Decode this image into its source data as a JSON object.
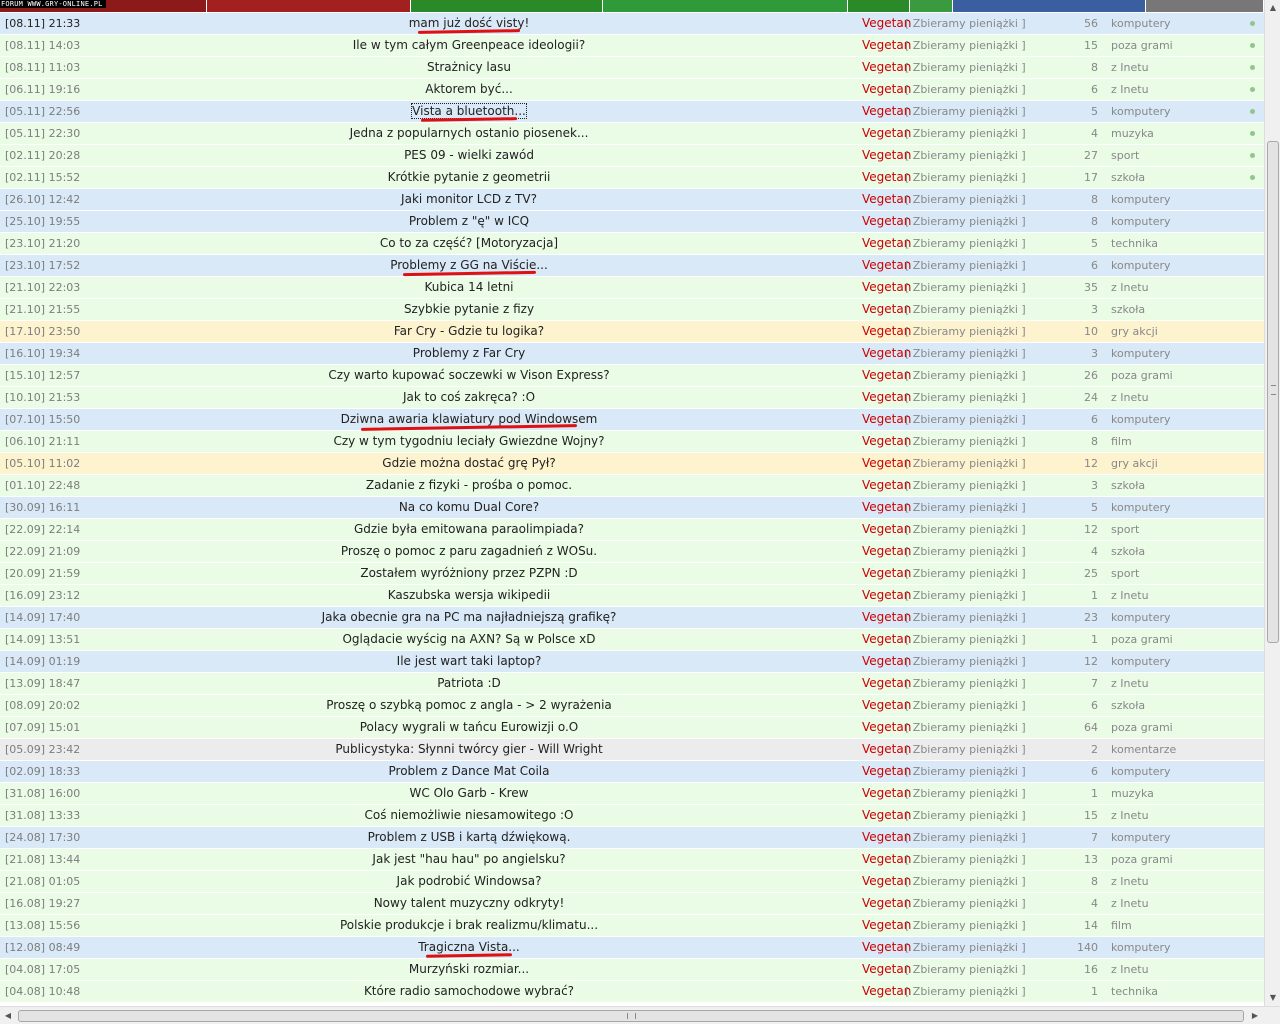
{
  "site_label": "FORUM WWW.GRY-ONLINE.PL",
  "colors": {
    "author": "#cc0000",
    "row_green": "#eafbe6",
    "row_blue": "#d9e9f7",
    "row_yellow": "#fdf3cf",
    "row_gray": "#ececec",
    "underline": "#e01010"
  },
  "threads": [
    {
      "date": "[08.11] 21:33",
      "title": "mam już dość visty!",
      "author": "Vegetan",
      "team": "[ Zbieramy pieniążki ]",
      "count": "56",
      "category": "komputery",
      "dot": true,
      "color": "blue",
      "underlined": true
    },
    {
      "date": "[08.11] 14:03",
      "title": "Ile w tym całym Greenpeace ideologii?",
      "author": "Vegetan",
      "team": "[ Zbieramy pieniążki ]",
      "count": "15",
      "category": "poza grami",
      "dot": true,
      "color": "green"
    },
    {
      "date": "[08.11] 11:03",
      "title": "Strażnicy lasu",
      "author": "Vegetan",
      "team": "[ Zbieramy pieniążki ]",
      "count": "8",
      "category": "z Inetu",
      "dot": true,
      "color": "green"
    },
    {
      "date": "[06.11] 19:16",
      "title": "Aktorem być...",
      "author": "Vegetan",
      "team": "[ Zbieramy pieniążki ]",
      "count": "6",
      "category": "z Inetu",
      "dot": true,
      "color": "green"
    },
    {
      "date": "[05.11] 22:56",
      "title": "Vista a bluetooth...",
      "author": "Vegetan",
      "team": "[ Zbieramy pieniążki ]",
      "count": "5",
      "category": "komputery",
      "dot": true,
      "color": "blue",
      "underlined": true,
      "boxed": true
    },
    {
      "date": "[05.11] 22:30",
      "title": "Jedna z popularnych ostanio piosenek...",
      "author": "Vegetan",
      "team": "[ Zbieramy pieniążki ]",
      "count": "4",
      "category": "muzyka",
      "dot": true,
      "color": "green"
    },
    {
      "date": "[02.11] 20:28",
      "title": "PES 09 - wielki zawód",
      "author": "Vegetan",
      "team": "[ Zbieramy pieniążki ]",
      "count": "27",
      "category": "sport",
      "dot": true,
      "color": "green"
    },
    {
      "date": "[02.11] 15:52",
      "title": "Krótkie pytanie z geometrii",
      "author": "Vegetan",
      "team": "[ Zbieramy pieniążki ]",
      "count": "17",
      "category": "szkoła",
      "dot": true,
      "color": "green"
    },
    {
      "date": "[26.10] 12:42",
      "title": "Jaki monitor LCD z TV?",
      "author": "Vegetan",
      "team": "[ Zbieramy pieniążki ]",
      "count": "8",
      "category": "komputery",
      "color": "blue"
    },
    {
      "date": "[25.10] 19:55",
      "title": "Problem z \"ę\" w ICQ",
      "author": "Vegetan",
      "team": "[ Zbieramy pieniążki ]",
      "count": "8",
      "category": "komputery",
      "color": "blue"
    },
    {
      "date": "[23.10] 21:20",
      "title": "Co to za część? [Motoryzacja]",
      "author": "Vegetan",
      "team": "[ Zbieramy pieniążki ]",
      "count": "5",
      "category": "technika",
      "color": "green"
    },
    {
      "date": "[23.10] 17:52",
      "title": "Problemy z GG na Viście...",
      "author": "Vegetan",
      "team": "[ Zbieramy pieniążki ]",
      "count": "6",
      "category": "komputery",
      "color": "blue",
      "underlined": true
    },
    {
      "date": "[21.10] 22:03",
      "title": "Kubica 14 letni",
      "author": "Vegetan",
      "team": "[ Zbieramy pieniążki ]",
      "count": "35",
      "category": "z Inetu",
      "color": "green"
    },
    {
      "date": "[21.10] 21:55",
      "title": "Szybkie pytanie z fizy",
      "author": "Vegetan",
      "team": "[ Zbieramy pieniążki ]",
      "count": "3",
      "category": "szkoła",
      "color": "green"
    },
    {
      "date": "[17.10] 23:50",
      "title": "Far Cry - Gdzie tu logika?",
      "author": "Vegetan",
      "team": "[ Zbieramy pieniążki ]",
      "count": "10",
      "category": "gry akcji",
      "color": "yellow"
    },
    {
      "date": "[16.10] 19:34",
      "title": "Problemy z Far Cry",
      "author": "Vegetan",
      "team": "[ Zbieramy pieniążki ]",
      "count": "3",
      "category": "komputery",
      "color": "blue"
    },
    {
      "date": "[15.10] 12:57",
      "title": "Czy warto kupować soczewki w Vison Express?",
      "author": "Vegetan",
      "team": "[ Zbieramy pieniążki ]",
      "count": "26",
      "category": "poza grami",
      "color": "green"
    },
    {
      "date": "[10.10] 21:53",
      "title": "Jak to coś zakręca? :O",
      "author": "Vegetan",
      "team": "[ Zbieramy pieniążki ]",
      "count": "24",
      "category": "z Inetu",
      "color": "green"
    },
    {
      "date": "[07.10] 15:50",
      "title": "Dziwna awaria klawiatury pod Windowsem",
      "author": "Vegetan",
      "team": "[ Zbieramy pieniążki ]",
      "count": "6",
      "category": "komputery",
      "color": "blue",
      "underlined": true
    },
    {
      "date": "[06.10] 21:11",
      "title": "Czy w tym tygodniu leciały Gwiezdne Wojny?",
      "author": "Vegetan",
      "team": "[ Zbieramy pieniążki ]",
      "count": "8",
      "category": "film",
      "color": "green"
    },
    {
      "date": "[05.10] 11:02",
      "title": "Gdzie można dostać grę Pył?",
      "author": "Vegetan",
      "team": "[ Zbieramy pieniążki ]",
      "count": "12",
      "category": "gry akcji",
      "color": "yellow"
    },
    {
      "date": "[01.10] 22:48",
      "title": "Zadanie z fizyki - prośba o pomoc.",
      "author": "Vegetan",
      "team": "[ Zbieramy pieniążki ]",
      "count": "3",
      "category": "szkoła",
      "color": "green"
    },
    {
      "date": "[30.09] 16:11",
      "title": "Na co komu Dual Core?",
      "author": "Vegetan",
      "team": "[ Zbieramy pieniążki ]",
      "count": "5",
      "category": "komputery",
      "color": "blue"
    },
    {
      "date": "[22.09] 22:14",
      "title": "Gdzie była emitowana paraolimpiada?",
      "author": "Vegetan",
      "team": "[ Zbieramy pieniążki ]",
      "count": "12",
      "category": "sport",
      "color": "green"
    },
    {
      "date": "[22.09] 21:09",
      "title": "Proszę o pomoc z paru zagadnień z WOSu.",
      "author": "Vegetan",
      "team": "[ Zbieramy pieniążki ]",
      "count": "4",
      "category": "szkoła",
      "color": "green"
    },
    {
      "date": "[20.09] 21:59",
      "title": "Zostałem wyróżniony przez PZPN :D",
      "author": "Vegetan",
      "team": "[ Zbieramy pieniążki ]",
      "count": "25",
      "category": "sport",
      "color": "green"
    },
    {
      "date": "[16.09] 23:12",
      "title": "Kaszubska wersja wikipedii",
      "author": "Vegetan",
      "team": "[ Zbieramy pieniążki ]",
      "count": "1",
      "category": "z Inetu",
      "color": "green"
    },
    {
      "date": "[14.09] 17:40",
      "title": "Jaka obecnie gra na PC ma najładniejszą grafikę?",
      "author": "Vegetan",
      "team": "[ Zbieramy pieniążki ]",
      "count": "23",
      "category": "komputery",
      "color": "blue"
    },
    {
      "date": "[14.09] 13:51",
      "title": "Oglądacie wyścig na AXN? Są w Polsce xD",
      "author": "Vegetan",
      "team": "[ Zbieramy pieniążki ]",
      "count": "1",
      "category": "poza grami",
      "color": "green"
    },
    {
      "date": "[14.09] 01:19",
      "title": "Ile jest wart taki laptop?",
      "author": "Vegetan",
      "team": "[ Zbieramy pieniążki ]",
      "count": "12",
      "category": "komputery",
      "color": "blue"
    },
    {
      "date": "[13.09] 18:47",
      "title": "Patriota :D",
      "author": "Vegetan",
      "team": "[ Zbieramy pieniążki ]",
      "count": "7",
      "category": "z Inetu",
      "color": "green"
    },
    {
      "date": "[08.09] 20:02",
      "title": "Proszę o szybką pomoc z angla - > 2 wyrażenia",
      "author": "Vegetan",
      "team": "[ Zbieramy pieniążki ]",
      "count": "6",
      "category": "szkoła",
      "color": "green"
    },
    {
      "date": "[07.09] 15:01",
      "title": "Polacy wygrali w tańcu Eurowizji o.O",
      "author": "Vegetan",
      "team": "[ Zbieramy pieniążki ]",
      "count": "64",
      "category": "poza grami",
      "color": "green"
    },
    {
      "date": "[05.09] 23:42",
      "title": "Publicystyka: Słynni twórcy gier - Will Wright",
      "author": "Vegetan",
      "team": "[ Zbieramy pieniążki ]",
      "count": "2",
      "category": "komentarze",
      "color": "gray"
    },
    {
      "date": "[02.09] 18:33",
      "title": "Problem z Dance Mat Coila",
      "author": "Vegetan",
      "team": "[ Zbieramy pieniążki ]",
      "count": "6",
      "category": "komputery",
      "color": "blue"
    },
    {
      "date": "[31.08] 16:00",
      "title": "WC Olo Garb - Krew",
      "author": "Vegetan",
      "team": "[ Zbieramy pieniążki ]",
      "count": "1",
      "category": "muzyka",
      "color": "green"
    },
    {
      "date": "[31.08] 13:33",
      "title": "Coś niemożliwie niesamowitego :O",
      "author": "Vegetan",
      "team": "[ Zbieramy pieniążki ]",
      "count": "15",
      "category": "z Inetu",
      "color": "green"
    },
    {
      "date": "[24.08] 17:30",
      "title": "Problem z USB i kartą dźwiękową.",
      "author": "Vegetan",
      "team": "[ Zbieramy pieniążki ]",
      "count": "7",
      "category": "komputery",
      "color": "blue"
    },
    {
      "date": "[21.08] 13:44",
      "title": "Jak jest \"hau hau\" po angielsku?",
      "author": "Vegetan",
      "team": "[ Zbieramy pieniążki ]",
      "count": "13",
      "category": "poza grami",
      "color": "green"
    },
    {
      "date": "[21.08] 01:05",
      "title": "Jak podrobić Windowsa?",
      "author": "Vegetan",
      "team": "[ Zbieramy pieniążki ]",
      "count": "8",
      "category": "z Inetu",
      "color": "green"
    },
    {
      "date": "[16.08] 19:27",
      "title": "Nowy talent muzyczny odkryty!",
      "author": "Vegetan",
      "team": "[ Zbieramy pieniążki ]",
      "count": "4",
      "category": "z Inetu",
      "color": "green"
    },
    {
      "date": "[13.08] 15:56",
      "title": "Polskie produkcje i brak realizmu/klimatu...",
      "author": "Vegetan",
      "team": "[ Zbieramy pieniążki ]",
      "count": "14",
      "category": "film",
      "color": "green"
    },
    {
      "date": "[12.08] 08:49",
      "title": "Tragiczna Vista...",
      "author": "Vegetan",
      "team": "[ Zbieramy pieniążki ]",
      "count": "140",
      "category": "komputery",
      "color": "blue",
      "underlined": true
    },
    {
      "date": "[04.08] 17:05",
      "title": "Murzyński rozmiar...",
      "author": "Vegetan",
      "team": "[ Zbieramy pieniążki ]",
      "count": "16",
      "category": "z Inetu",
      "color": "green"
    },
    {
      "date": "[04.08] 10:48",
      "title": "Które radio samochodowe wybrać?",
      "author": "Vegetan",
      "team": "[ Zbieramy pieniążki ]",
      "count": "1",
      "category": "technika",
      "color": "green"
    }
  ]
}
